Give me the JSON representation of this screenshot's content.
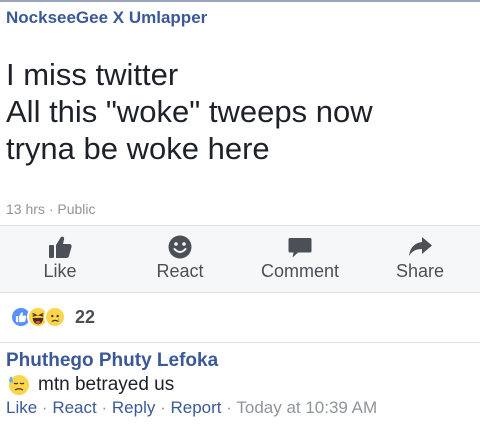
{
  "post": {
    "author": "NockseeGee X Umlapper",
    "text_lines": [
      "I miss twitter",
      "All this \"woke\" tweeps now",
      "tryna be woke here"
    ],
    "time": "13 hrs",
    "separator": "·",
    "privacy": "Public"
  },
  "actions": {
    "like": {
      "label": "Like",
      "icon": "thumbs-up-icon"
    },
    "react": {
      "label": "React",
      "icon": "smiley-icon"
    },
    "comment": {
      "label": "Comment",
      "icon": "speech-bubble-icon"
    },
    "share": {
      "label": "Share",
      "icon": "share-arrow-icon"
    }
  },
  "reactions": {
    "icons": [
      "like-reaction-icon",
      "haha-reaction-icon",
      "sad-reaction-icon"
    ],
    "count": "22"
  },
  "comment": {
    "author": "Phuthego Phuty Lefoka",
    "emoji": "sweat-face-icon",
    "text": "mtn betrayed us",
    "links": {
      "like": "Like",
      "react": "React",
      "reply": "Reply",
      "report": "Report",
      "separator": "·",
      "timestamp": "Today at 10:39 AM"
    }
  },
  "colors": {
    "link_blue": "#3b5998",
    "meta_gray": "#90949c",
    "action_gray": "#4b4f56",
    "action_bar_bg": "#f6f7f9",
    "like_blue": "#5890ff",
    "emoji_yellow": "#fbd54b"
  }
}
